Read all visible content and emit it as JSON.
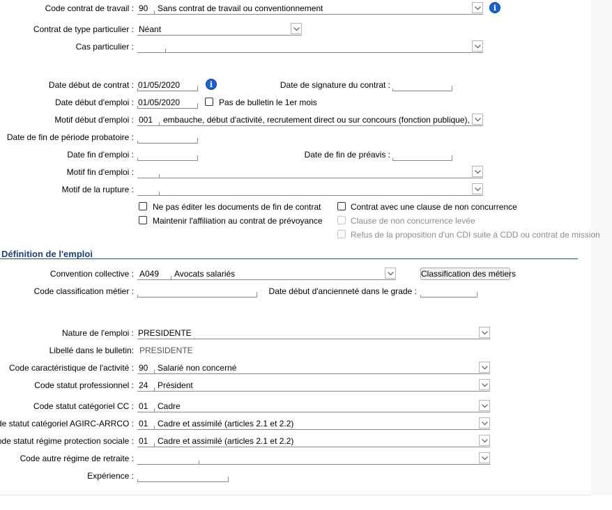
{
  "contrat": {
    "code_contrat_travail": {
      "label": "Code contrat de travail :",
      "code": "90",
      "value": "Sans contrat de travail ou conventionnement"
    },
    "type_particulier": {
      "label": "Contrat de type particulier :",
      "value": "Néant"
    },
    "cas_particulier": {
      "label": "Cas particulier :",
      "value": ""
    },
    "date_debut_contrat": {
      "label": "Date début de contrat :",
      "value": "01/05/2020"
    },
    "date_signature": {
      "label": "Date de signature du contrat :",
      "value": ""
    },
    "date_debut_emploi": {
      "label": "Date début d'emploi :",
      "value": "01/05/2020"
    },
    "pas_bulletin": {
      "label": "Pas de bulletin le 1er mois",
      "checked": false
    },
    "motif_debut": {
      "label": "Motif début d'emploi :",
      "code": "001",
      "value": "embauche, début d'activité, recrutement direct ou sur concours (fonction publique), début de c"
    },
    "date_fin_probatoire": {
      "label": "Date de fin de période probatoire :",
      "value": ""
    },
    "date_fin_emploi": {
      "label": "Date fin d'emploi :",
      "value": ""
    },
    "date_fin_preavis": {
      "label": "Date de fin de préavis :",
      "value": ""
    },
    "motif_fin": {
      "label": "Motif fin d'emploi :",
      "value": ""
    },
    "motif_rupture": {
      "label": "Motif de la rupture :",
      "value": ""
    },
    "checkboxes": {
      "ne_pas_editer": {
        "label": "Ne pas éditer les documents de fin de contrat",
        "checked": false
      },
      "maintenir_affiliation": {
        "label": "Maintenir l'affiliation au contrat de prévoyance",
        "checked": false
      },
      "clause_non_concurrence": {
        "label": "Contrat avec une clause de non concurrence",
        "checked": false
      },
      "clause_levee": {
        "label": "Clause de non concurrence levée",
        "checked": false,
        "disabled": true
      },
      "refus_cdi": {
        "label": "Refus de la proposition d'un CDI suite à CDD ou contrat de mission",
        "checked": false,
        "disabled": true
      }
    }
  },
  "emploi": {
    "section_title": "Définition de l'emploi",
    "convention": {
      "label": "Convention collective :",
      "code": "A049",
      "value": "Avocats salariés"
    },
    "classification_button": "Classification des métiers",
    "code_classification": {
      "label": "Code classification métier :",
      "value": ""
    },
    "date_anciennete": {
      "label": "Date début d'ancienneté dans le grade :",
      "value": ""
    },
    "nature_emploi": {
      "label": "Nature de l'emploi :",
      "value": "PRESIDENTE"
    },
    "libelle_bulletin": {
      "label": "Libellé dans le bulletin:",
      "value": "PRESIDENTE"
    },
    "code_activite": {
      "label": "Code caractéristique de l'activité :",
      "code": "90",
      "value": "Salarié non concerné"
    },
    "statut_pro": {
      "label": "Code statut professionnel :",
      "code": "24",
      "value": "Président"
    },
    "statut_cc": {
      "label": "Code statut catégoriel CC :",
      "code": "01",
      "value": "Cadre"
    },
    "statut_agirc": {
      "label": "Code statut catégoriel AGIRC-ARRCO :",
      "code": "01",
      "value": "Cadre et assimilé (articles 2.1 et 2.2)"
    },
    "statut_protection": {
      "label": "Code statut régime protection sociale :",
      "code": "01",
      "value": "Cadre et assimilé (articles 2.1 et 2.2)"
    },
    "autre_regime": {
      "label": "Code autre régime de retraite :",
      "value": ""
    },
    "experience": {
      "label": "Expérience :",
      "value": ""
    }
  },
  "icons": {
    "info": "info-icon",
    "dropdown": "chevron-down-icon"
  },
  "colors": {
    "info_blue": "#1a63d6",
    "section_blue": "#1f3f77"
  }
}
